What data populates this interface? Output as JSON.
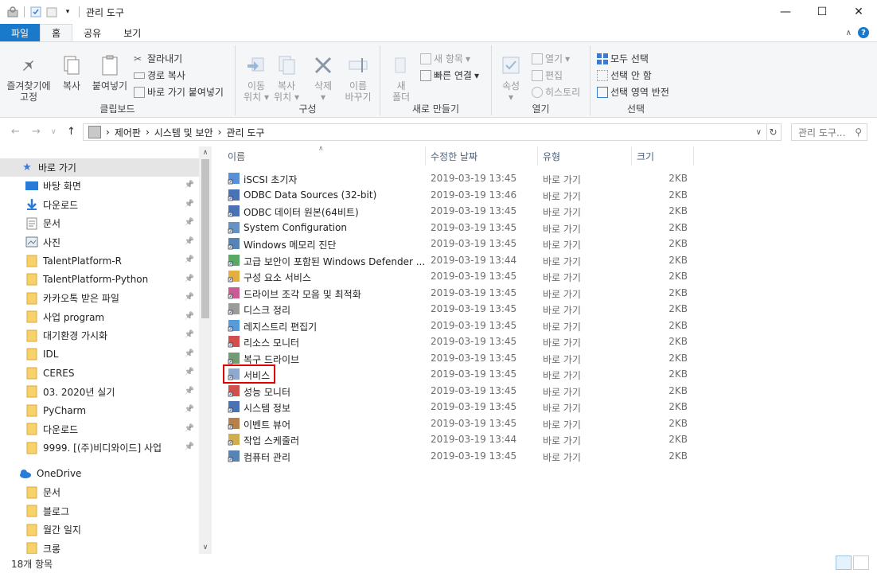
{
  "window": {
    "title": "관리 도구",
    "controls": {
      "minimize": "—",
      "maximize": "☐",
      "close": "✕"
    }
  },
  "tabs": [
    "파일",
    "홈",
    "공유",
    "보기"
  ],
  "ribbon": {
    "clipboard": {
      "pin_label_1": "즐겨찾기에",
      "pin_label_2": "고정",
      "copy": "복사",
      "paste": "붙여넣기",
      "cut": "잘라내기",
      "copy_path": "경로 복사",
      "paste_shortcut": "바로 가기 붙여넣기",
      "group": "클립보드"
    },
    "organize": {
      "move_1": "이동",
      "move_2": "위치",
      "copy_1": "복사",
      "copy_2": "위치",
      "delete": "삭제",
      "rename_1": "이름",
      "rename_2": "바꾸기",
      "group": "구성"
    },
    "new": {
      "folder_1": "새",
      "folder_2": "폴더",
      "new_item": "새 항목",
      "easy_access": "빠른 연결",
      "group": "새로 만들기"
    },
    "open": {
      "properties": "속성",
      "open": "열기",
      "edit": "편집",
      "history": "히스토리",
      "group": "열기"
    },
    "select": {
      "select_all": "모두 선택",
      "select_none": "선택 안 함",
      "invert": "선택 영역 반전",
      "group": "선택"
    }
  },
  "address": {
    "crumbs": [
      "제어판",
      "시스템 및 보안",
      "관리 도구"
    ],
    "search_placeholder": "관리 도구..."
  },
  "nav": {
    "quick_access": "바로 가기",
    "items": [
      {
        "label": "바탕 화면",
        "icon": "desktop-icon"
      },
      {
        "label": "다운로드",
        "icon": "download-icon"
      },
      {
        "label": "문서",
        "icon": "document-icon"
      },
      {
        "label": "사진",
        "icon": "picture-icon"
      },
      {
        "label": "TalentPlatform-R",
        "icon": "folder-icon"
      },
      {
        "label": "TalentPlatform-Python",
        "icon": "folder-icon"
      },
      {
        "label": "카카오톡 받은 파일",
        "icon": "folder-icon"
      },
      {
        "label": "사업 program",
        "icon": "folder-icon"
      },
      {
        "label": "대기환경 가시화",
        "icon": "folder-icon"
      },
      {
        "label": "IDL",
        "icon": "folder-icon"
      },
      {
        "label": "CERES",
        "icon": "folder-icon"
      },
      {
        "label": "03. 2020년 실기",
        "icon": "folder-icon"
      },
      {
        "label": "PyCharm",
        "icon": "folder-icon"
      },
      {
        "label": "다운로드",
        "icon": "folder-icon"
      },
      {
        "label": "9999. [(주)비디와이드] 사업",
        "icon": "folder-icon"
      }
    ],
    "onedrive": "OneDrive",
    "onedrive_items": [
      "문서",
      "블로그",
      "월간 일지",
      "크롱"
    ]
  },
  "columns": {
    "name": "이름",
    "date": "수정한 날짜",
    "type": "유형",
    "size": "크기"
  },
  "files": [
    {
      "name": "iSCSI 초기자",
      "date": "2019-03-19 13:45",
      "type": "바로 가기",
      "size": "2KB",
      "color": "#3a7bd5"
    },
    {
      "name": "ODBC Data Sources (32-bit)",
      "date": "2019-03-19 13:46",
      "type": "바로 가기",
      "size": "2KB",
      "color": "#2a5aa8"
    },
    {
      "name": "ODBC 데이터 원본(64비트)",
      "date": "2019-03-19 13:45",
      "type": "바로 가기",
      "size": "2KB",
      "color": "#2a5aa8"
    },
    {
      "name": "System Configuration",
      "date": "2019-03-19 13:45",
      "type": "바로 가기",
      "size": "2KB",
      "color": "#4a7fb8"
    },
    {
      "name": "Windows 메모리 진단",
      "date": "2019-03-19 13:45",
      "type": "바로 가기",
      "size": "2KB",
      "color": "#3a6fa8"
    },
    {
      "name": "고급 보안이 포함된 Windows Defender ...",
      "date": "2019-03-19 13:44",
      "type": "바로 가기",
      "size": "2KB",
      "color": "#3a9a4a"
    },
    {
      "name": "구성 요소 서비스",
      "date": "2019-03-19 13:45",
      "type": "바로 가기",
      "size": "2KB",
      "color": "#e0a020"
    },
    {
      "name": "드라이브 조각 모음 및 최적화",
      "date": "2019-03-19 13:45",
      "type": "바로 가기",
      "size": "2KB",
      "color": "#c04080"
    },
    {
      "name": "디스크 정리",
      "date": "2019-03-19 13:45",
      "type": "바로 가기",
      "size": "2KB",
      "color": "#8a8a8a"
    },
    {
      "name": "레지스트리 편집기",
      "date": "2019-03-19 13:45",
      "type": "바로 가기",
      "size": "2KB",
      "color": "#3a8ad5"
    },
    {
      "name": "리소스 모니터",
      "date": "2019-03-19 13:45",
      "type": "바로 가기",
      "size": "2KB",
      "color": "#c83030"
    },
    {
      "name": "복구 드라이브",
      "date": "2019-03-19 13:45",
      "type": "바로 가기",
      "size": "2KB",
      "color": "#5a8a5a"
    },
    {
      "name": "서비스",
      "date": "2019-03-19 13:45",
      "type": "바로 가기",
      "size": "2KB",
      "color": "#7a9ac8"
    },
    {
      "name": "성능 모니터",
      "date": "2019-03-19 13:45",
      "type": "바로 가기",
      "size": "2KB",
      "color": "#c83030"
    },
    {
      "name": "시스템 정보",
      "date": "2019-03-19 13:45",
      "type": "바로 가기",
      "size": "2KB",
      "color": "#2a5aa8"
    },
    {
      "name": "이벤트 뷰어",
      "date": "2019-03-19 13:45",
      "type": "바로 가기",
      "size": "2KB",
      "color": "#a86a2a"
    },
    {
      "name": "작업 스케줄러",
      "date": "2019-03-19 13:44",
      "type": "바로 가기",
      "size": "2KB",
      "color": "#c8a030"
    },
    {
      "name": "컴퓨터 관리",
      "date": "2019-03-19 13:45",
      "type": "바로 가기",
      "size": "2KB",
      "color": "#3a6fa8"
    }
  ],
  "status": {
    "count": "18개 항목"
  },
  "colors": {
    "accent": "#1979ca",
    "highlight": "#e00000"
  }
}
